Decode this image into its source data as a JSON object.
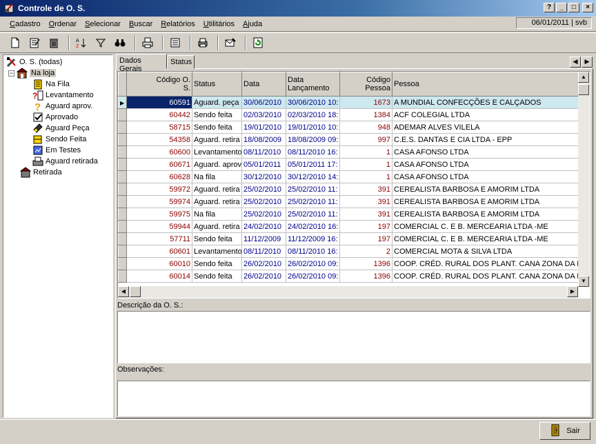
{
  "window": {
    "title": "Controle de O. S.",
    "buttons": [
      "?",
      "_",
      "□",
      "×"
    ]
  },
  "menu": [
    "Cadastro",
    "Ordenar",
    "Selecionar",
    "Buscar",
    "Relatórios",
    "Utilitários",
    "Ajuda"
  ],
  "status_date": "06/01/2011 | svb",
  "toolbar": [
    "new-doc-icon",
    "edit-doc-icon",
    "trash-icon",
    "sort-az-icon",
    "filter-icon",
    "binoculars-icon",
    "print-icon",
    "list-icon",
    "printer2-icon",
    "email-icon",
    "refresh-icon"
  ],
  "tree": {
    "root": "O. S. (todas)",
    "na_loja": "Na loja",
    "children": [
      "Na Fila",
      "Levantamento",
      "Aguard aprov.",
      "Aprovado",
      "Aguard Peça",
      "Sendo Feita",
      "Em Testes",
      "Aguard retirada"
    ],
    "retirada": "Retirada"
  },
  "tabs": [
    "Dados Gerais",
    "Status"
  ],
  "grid": {
    "headers": [
      "Código O. S.",
      "Status",
      "Data",
      "Data Lançamento",
      "Código Pessoa",
      "Pessoa"
    ],
    "rows": [
      [
        "60591",
        "Aguard. peça",
        "30/06/2010",
        "30/06/2010 10:",
        "1673",
        "A MUNDIAL CONFECÇÕES E CALÇADOS"
      ],
      [
        "60442",
        "Sendo feita",
        "02/03/2010",
        "02/03/2010 18:",
        "1384",
        "ACF COLEGIAL LTDA"
      ],
      [
        "58715",
        "Sendo feita",
        "19/01/2010",
        "19/01/2010 10:",
        "948",
        "ADEMAR ALVES VILELA"
      ],
      [
        "54358",
        "Aguard. retira",
        "18/08/2009",
        "18/08/2009 09:",
        "997",
        "C.E.S. DANTAS E CIA LTDA - EPP"
      ],
      [
        "60600",
        "Levantamento",
        "08/11/2010",
        "08/11/2010 16:",
        "1",
        "CASA AFONSO LTDA"
      ],
      [
        "60671",
        "Aguard. aprov",
        "05/01/2011",
        "05/01/2011 17:",
        "1",
        "CASA AFONSO LTDA"
      ],
      [
        "60628",
        "Na fila",
        "30/12/2010",
        "30/12/2010 14:",
        "1",
        "CASA AFONSO LTDA"
      ],
      [
        "59972",
        "Aguard. retira",
        "25/02/2010",
        "25/02/2010 11:",
        "391",
        "CEREALISTA BARBOSA E AMORIM LTDA"
      ],
      [
        "59974",
        "Aguard. retira",
        "25/02/2010",
        "25/02/2010 11:",
        "391",
        "CEREALISTA BARBOSA E AMORIM LTDA"
      ],
      [
        "59975",
        "Na fila",
        "25/02/2010",
        "25/02/2010 11:",
        "391",
        "CEREALISTA BARBOSA E AMORIM LTDA"
      ],
      [
        "59944",
        "Aguard. retira",
        "24/02/2010",
        "24/02/2010 16:",
        "197",
        "COMERCIAL C. E B. MERCEARIA LTDA -ME"
      ],
      [
        "57711",
        "Sendo feita",
        "11/12/2009",
        "11/12/2009 16:",
        "197",
        "COMERCIAL C. E B. MERCEARIA LTDA -ME"
      ],
      [
        "60601",
        "Levantamento",
        "08/11/2010",
        "08/11/2010 16:",
        "2",
        "COMERCIAL MOTA & SILVA LTDA"
      ],
      [
        "60010",
        "Sendo feita",
        "26/02/2010",
        "26/02/2010 09:",
        "1396",
        "COOP. CRÉD. RURAL DOS PLANT. CANA ZONA DA MAT"
      ],
      [
        "60014",
        "Sendo feita",
        "26/02/2010",
        "26/02/2010 09:",
        "1396",
        "COOP. CRÉD. RURAL DOS PLANT. CANA ZONA DA MAT"
      ]
    ]
  },
  "descricao_label": "Descrição da O. S.:",
  "observacoes_label": "Observações:",
  "sair_label": "Sair"
}
